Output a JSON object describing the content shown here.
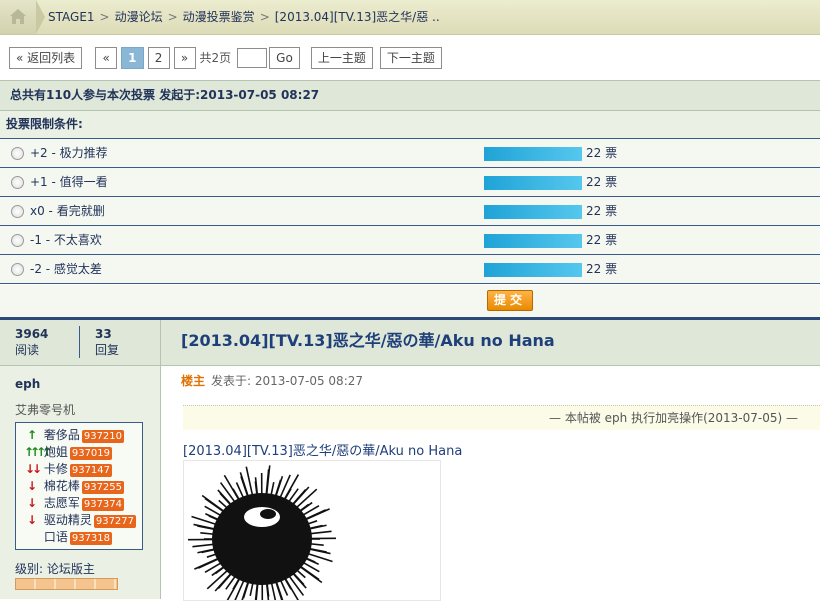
{
  "breadcrumb": {
    "items": [
      "STAGE1",
      "动漫论坛",
      "动漫投票鉴赏",
      "[2013.04][TV.13]恶之华/惡 .."
    ],
    "separator": ">"
  },
  "pager": {
    "back_label": "« 返回列表",
    "prev_label": "«",
    "pages": [
      "1",
      "2"
    ],
    "current": "1",
    "next_label": "»",
    "total": "共2页",
    "go_label": "Go",
    "prev_topic": "上一主题",
    "next_topic": "下一主题"
  },
  "poll": {
    "summary": "总共有110人参与本次投票 发起于:2013-07-05 08:27",
    "limit_label": "投票限制条件:",
    "options": [
      {
        "label": "+2 - 极力推荐",
        "votes": "22 票"
      },
      {
        "label": "+1 - 值得一看",
        "votes": "22 票"
      },
      {
        "label": "x0 - 看完就删",
        "votes": "22 票"
      },
      {
        "label": "-1 - 不太喜欢",
        "votes": "22 票"
      },
      {
        "label": "-2 - 感觉太差",
        "votes": "22 票"
      }
    ],
    "bar_fraction": 0.2,
    "submit_label": "提交"
  },
  "stats": {
    "views_count": "3964",
    "views_label": "阅读",
    "replies_count": "33",
    "replies_label": "回复"
  },
  "user": {
    "name": "eph",
    "title": "艾弗零号机",
    "medals": [
      {
        "arrow": "↑",
        "dir": "up",
        "name": "奢侈品",
        "tag": "937210"
      },
      {
        "arrow": "↑↑↑↑",
        "dir": "up",
        "name": "炮姐",
        "tag": "937019"
      },
      {
        "arrow": "↓↓",
        "dir": "down",
        "name": "卡修",
        "tag": "937147"
      },
      {
        "arrow": "↓",
        "dir": "down",
        "name": "棉花棒",
        "tag": "937255"
      },
      {
        "arrow": "↓",
        "dir": "down",
        "name": "志愿军",
        "tag": "937374"
      },
      {
        "arrow": "↓",
        "dir": "down",
        "name": "驱动精灵",
        "tag": "937277"
      },
      {
        "arrow": "",
        "dir": "none",
        "name": "口语",
        "tag": "937318"
      }
    ],
    "level": "级别: 论坛版主"
  },
  "thread": {
    "title": "[2013.04][TV.13]恶之华/惡の華/Aku no Hana",
    "role": "楼主",
    "posted": "发表于: 2013-07-05 08:27",
    "highlight_note": "— 本帖被 eph 执行加亮操作(2013-07-05) —",
    "post_title": "[2013.04][TV.13]恶之华/惡の華/Aku no Hana"
  },
  "colors": {
    "header_bg": "#dfe8d8",
    "bar": "#1fa3d6",
    "accent": "#1f3f7a",
    "submit": "#e98a00"
  }
}
